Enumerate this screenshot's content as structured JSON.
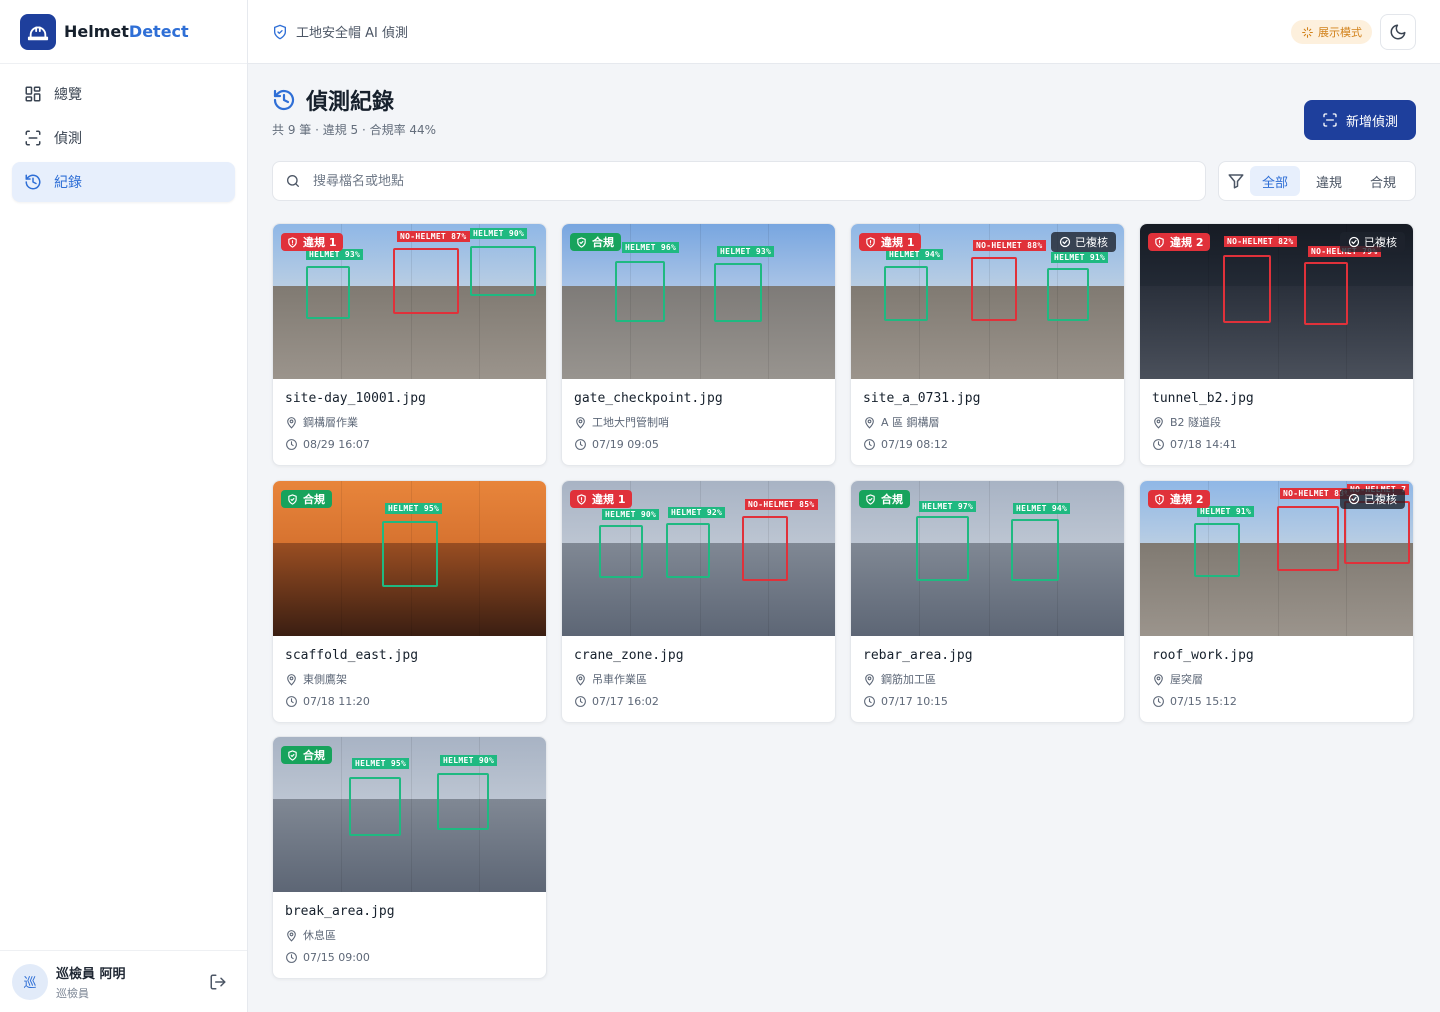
{
  "brand": {
    "name_a": "Helmet",
    "name_b": "Detect"
  },
  "sidebar": {
    "items": [
      {
        "label": "總覽",
        "icon": "dashboard-icon"
      },
      {
        "label": "偵測",
        "icon": "scan-icon"
      },
      {
        "label": "紀錄",
        "icon": "history-icon"
      }
    ]
  },
  "user": {
    "avatar": "巡",
    "name": "巡檢員 阿明",
    "role": "巡檢員"
  },
  "topbar": {
    "title": "工地安全帽 AI 偵測",
    "demo_label": "展示模式"
  },
  "page": {
    "title": "偵測紀錄",
    "subtitle": "共 9 筆 · 違規 5 · 合規率 44%",
    "new_button": "新增偵測"
  },
  "search": {
    "placeholder": "搜尋檔名或地點"
  },
  "filters": [
    {
      "label": "全部"
    },
    {
      "label": "違規"
    },
    {
      "label": "合規"
    }
  ],
  "statuses": {
    "ok": "合規",
    "bad_prefix": "違規"
  },
  "reviewed_label": "已複核",
  "colors": {
    "accent": "#2f6fd6",
    "primary": "#1e3f9c",
    "helmet": "#1fb981",
    "no_helmet": "#e0313a",
    "compliant": "#17a35c"
  },
  "records": [
    {
      "file": "site-day_10001.jpg",
      "place": "鋼構層作業",
      "time": "08/29 16:07",
      "violations": 1,
      "reviewed": false,
      "detections": [
        {
          "label": "HELMET 93%"
        },
        {
          "label": "NO-HELMET 87%"
        },
        {
          "label": "HELMET 90%"
        }
      ]
    },
    {
      "file": "gate_checkpoint.jpg",
      "place": "工地大門管制哨",
      "time": "07/19 09:05",
      "violations": 0,
      "reviewed": false,
      "detections": [
        {
          "label": "HELMET 96%"
        },
        {
          "label": "HELMET 93%"
        }
      ]
    },
    {
      "file": "site_a_0731.jpg",
      "place": "A 區 鋼構層",
      "time": "07/19 08:12",
      "violations": 1,
      "reviewed": true,
      "detections": [
        {
          "label": "HELMET 94%"
        },
        {
          "label": "NO-HELMET 88%"
        },
        {
          "label": "HELMET 91%"
        }
      ]
    },
    {
      "file": "tunnel_b2.jpg",
      "place": "B2 隧道段",
      "time": "07/18 14:41",
      "violations": 2,
      "reviewed": true,
      "detections": [
        {
          "label": "NO-HELMET 82%"
        },
        {
          "label": "NO-HELMET 79%"
        }
      ]
    },
    {
      "file": "scaffold_east.jpg",
      "place": "東側鷹架",
      "time": "07/18 11:20",
      "violations": 0,
      "reviewed": false,
      "detections": [
        {
          "label": "HELMET 95%"
        }
      ]
    },
    {
      "file": "crane_zone.jpg",
      "place": "吊車作業區",
      "time": "07/17 16:02",
      "violations": 1,
      "reviewed": false,
      "detections": [
        {
          "label": "HELMET 90%"
        },
        {
          "label": "HELMET 92%"
        },
        {
          "label": "NO-HELMET 85%"
        }
      ]
    },
    {
      "file": "rebar_area.jpg",
      "place": "鋼筋加工區",
      "time": "07/17 10:15",
      "violations": 0,
      "reviewed": false,
      "detections": [
        {
          "label": "HELMET 97%"
        },
        {
          "label": "HELMET 94%"
        }
      ]
    },
    {
      "file": "roof_work.jpg",
      "place": "屋突層",
      "time": "07/15 15:12",
      "violations": 2,
      "reviewed": true,
      "detections": [
        {
          "label": "HELMET 91%"
        },
        {
          "label": "NO-HELMET 83%"
        },
        {
          "label": "NO-HELMET 7"
        }
      ]
    },
    {
      "file": "break_area.jpg",
      "place": "休息區",
      "time": "07/15 09:00",
      "violations": 0,
      "reviewed": false,
      "detections": [
        {
          "label": "HELMET 95%"
        },
        {
          "label": "HELMET 90%"
        }
      ]
    }
  ]
}
